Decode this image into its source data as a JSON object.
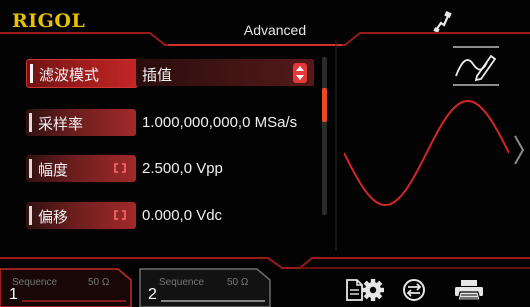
{
  "header": {
    "brand": "RIGOL",
    "title": "Advanced",
    "icons": [
      "usb-connect-icon"
    ]
  },
  "params": [
    {
      "label": "滤波模式",
      "value": "插值",
      "has_spinner": true,
      "active": true
    },
    {
      "label": "采样率",
      "value": "1.000,000,000,0 MSa/s",
      "has_link": false,
      "active": false
    },
    {
      "label": "幅度",
      "value": "2.500,0 Vpp",
      "has_link": true,
      "active": false
    },
    {
      "label": "偏移",
      "value": "0.000,0 Vdc",
      "has_link": true,
      "active": false
    }
  ],
  "channels": [
    {
      "number": "1",
      "mode": "Sequence",
      "impedance": "50 Ω"
    },
    {
      "number": "2",
      "mode": "Sequence",
      "impedance": "50 Ω"
    }
  ],
  "toolbar": {
    "icons": [
      "document-icon",
      "settings-gear-icon",
      "sync-icon",
      "printer-icon"
    ]
  },
  "colors": {
    "accent": "#d42b2b",
    "brand": "#e9c100",
    "scroll_thumb": "#e94a1e",
    "background": "#030303"
  },
  "preview": {
    "waveform": "sine",
    "scroll_position": 0.2
  }
}
